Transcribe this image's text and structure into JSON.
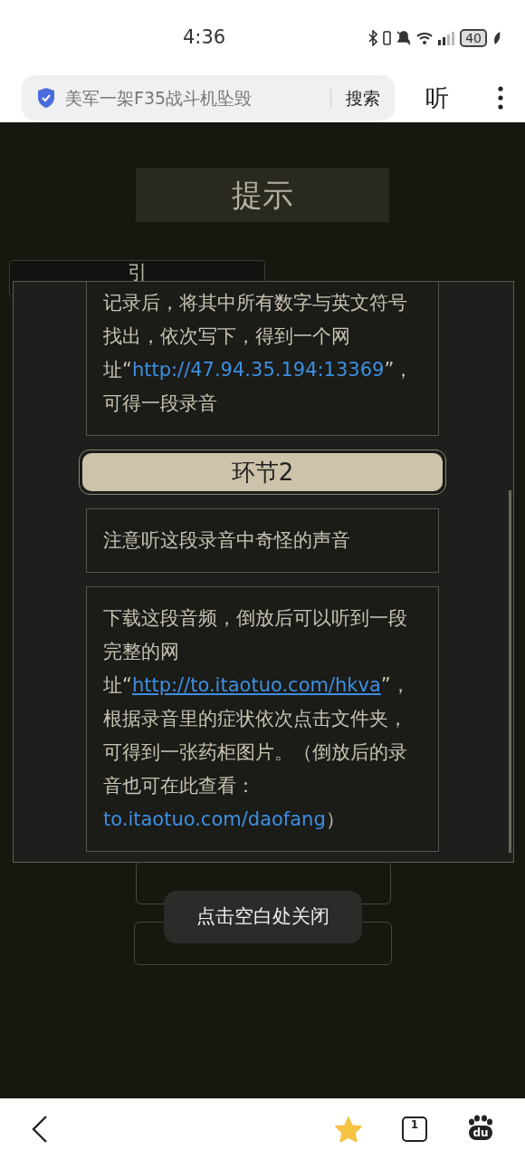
{
  "status_bar": {
    "time": "4:36",
    "battery": "40"
  },
  "search_bar": {
    "query": "美军一架F35战斗机坠毁",
    "search_button": "搜索",
    "listen_button": "听"
  },
  "background": {
    "card_label": "引"
  },
  "dialog": {
    "title": "提示",
    "items": [
      {
        "kind": "text",
        "segments": [
          {
            "kind": "text",
            "text": "记录后，将其中所有数字与英文符号找出，依次写下，得到一个网址“"
          },
          {
            "kind": "link",
            "text": "http://47.94.35.194:13369"
          },
          {
            "kind": "text",
            "text": "”，可得一段录音"
          }
        ]
      },
      {
        "kind": "header",
        "label": "环节2"
      },
      {
        "kind": "text",
        "segments": [
          {
            "kind": "text",
            "text": "注意听这段录音中奇怪的声音"
          }
        ]
      },
      {
        "kind": "text",
        "segments": [
          {
            "kind": "text",
            "text": "下载这段音频，倒放后可以听到一段完整的网址“"
          },
          {
            "kind": "link_underlined",
            "text": "http://to.itaotuo.com/hkva"
          },
          {
            "kind": "text",
            "text": "”，根据录音里的症状依次点击文件夹，可得到一张药柜图片。（倒放后的录音也可在此查看："
          },
          {
            "kind": "link",
            "text": "to.itaotuo.com/daofang"
          },
          {
            "kind": "text",
            "text": "）"
          }
        ]
      }
    ]
  },
  "toast": "点击空白处关闭",
  "bottom_nav": {
    "favorited": true,
    "tab_count": "1",
    "logo_text": "du"
  }
}
